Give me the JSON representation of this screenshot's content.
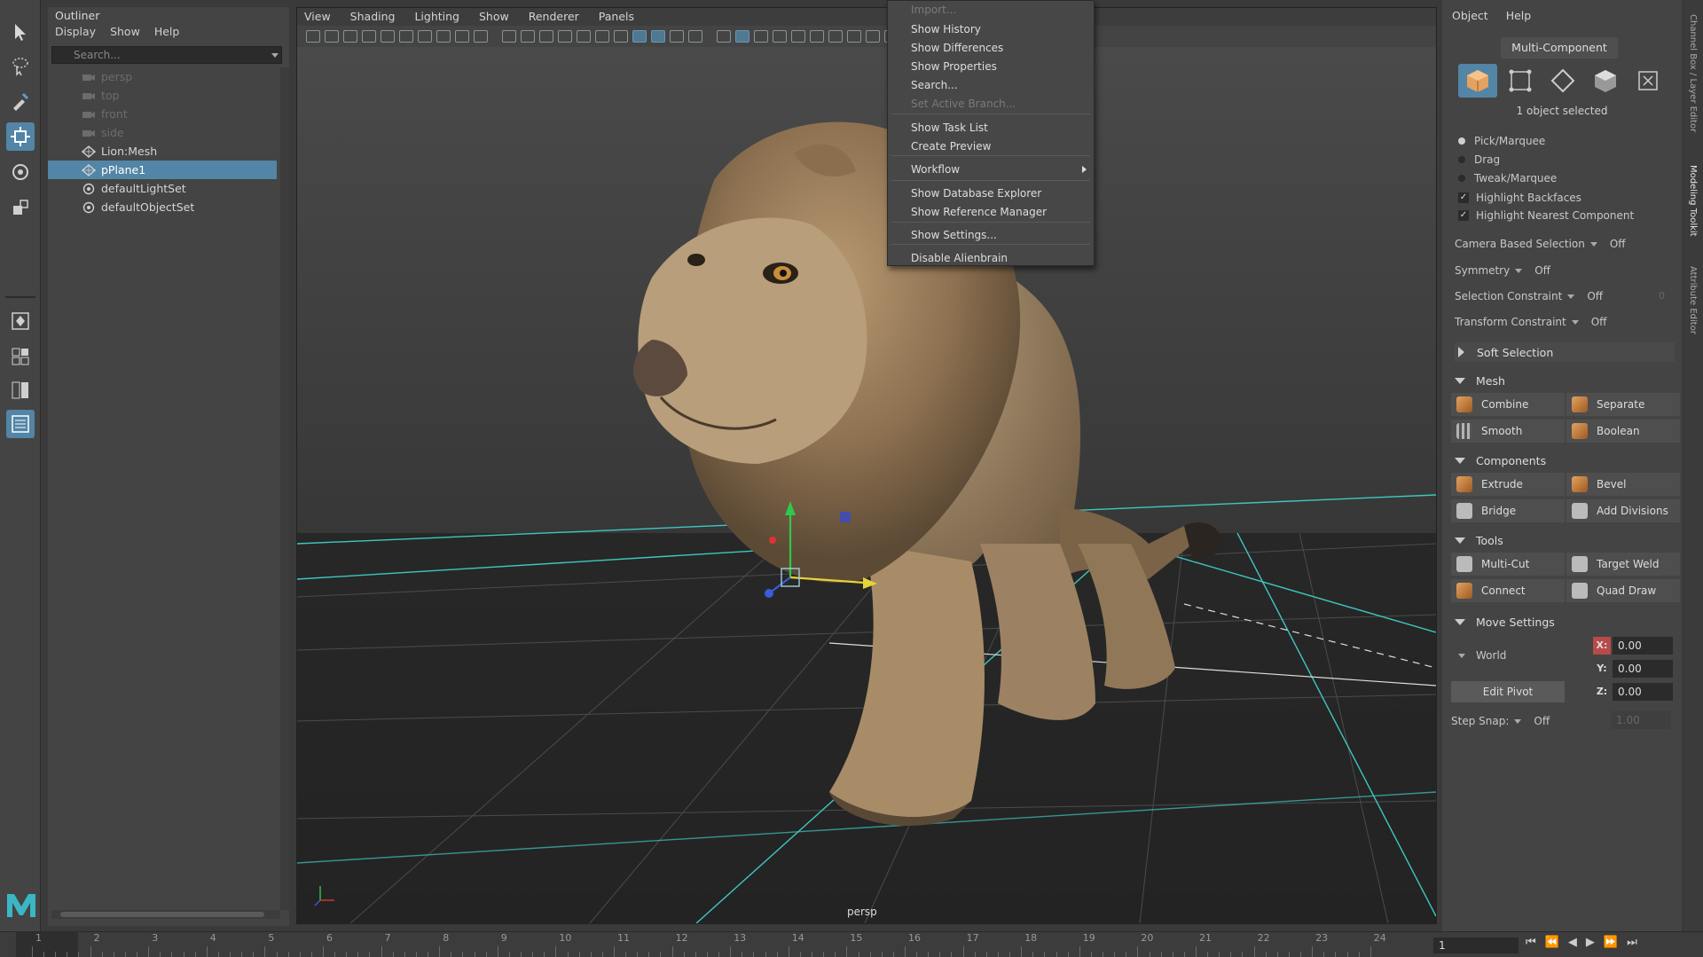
{
  "colors": {
    "accent": "#5285a6",
    "grid": "#3fc7c0",
    "x_axis": "#b84a4a"
  },
  "outliner": {
    "title": "Outliner",
    "menu": [
      "Display",
      "Show",
      "Help"
    ],
    "search_placeholder": "Search...",
    "items": [
      {
        "label": "persp",
        "icon": "camera-icon",
        "state": "dim"
      },
      {
        "label": "top",
        "icon": "camera-icon",
        "state": "dim"
      },
      {
        "label": "front",
        "icon": "camera-icon",
        "state": "dim"
      },
      {
        "label": "side",
        "icon": "camera-icon",
        "state": "dim"
      },
      {
        "label": "Lion:Mesh",
        "icon": "mesh-icon",
        "state": "normal"
      },
      {
        "label": "pPlane1",
        "icon": "mesh-icon",
        "state": "selected"
      },
      {
        "label": "defaultLightSet",
        "icon": "set-icon",
        "state": "normal"
      },
      {
        "label": "defaultObjectSet",
        "icon": "set-icon",
        "state": "normal"
      }
    ]
  },
  "viewport": {
    "menu": [
      "View",
      "Shading",
      "Lighting",
      "Show",
      "Renderer",
      "Panels"
    ],
    "camera_label": "persp"
  },
  "show_menu": {
    "items": [
      {
        "label": "Import...",
        "disabled": true
      },
      {
        "label": "Show History",
        "disabled": false
      },
      {
        "label": "Show Differences",
        "disabled": false
      },
      {
        "label": "Show Properties",
        "disabled": false
      },
      {
        "label": "Search...",
        "disabled": false
      },
      {
        "label": "Set Active Branch...",
        "disabled": true
      },
      {
        "label": "Show Task List",
        "disabled": false
      },
      {
        "label": "Create Preview",
        "disabled": false
      },
      {
        "label": "Workflow",
        "disabled": false,
        "submenu": true
      },
      {
        "label": "Show Database Explorer",
        "disabled": false
      },
      {
        "label": "Show Reference Manager",
        "disabled": false
      },
      {
        "label": "Show Settings...",
        "disabled": false
      },
      {
        "label": "Disable Alienbrain",
        "disabled": false
      }
    ]
  },
  "modeling_toolkit": {
    "menu": [
      "Object",
      "Help"
    ],
    "mode_label": "Multi-Component",
    "selection_modes": [
      "object-cube-icon",
      "vertex-icon",
      "edge-icon",
      "face-icon",
      "uv-icon"
    ],
    "selected_count_text": "1 object selected",
    "pick_options": [
      {
        "label": "Pick/Marquee",
        "selected": true
      },
      {
        "label": "Drag",
        "selected": false
      },
      {
        "label": "Tweak/Marquee",
        "selected": false
      }
    ],
    "checks": [
      {
        "label": "Highlight Backfaces",
        "checked": true
      },
      {
        "label": "Highlight Nearest Component",
        "checked": true
      }
    ],
    "dropdowns": [
      {
        "label": "Camera Based Selection",
        "value": "Off"
      },
      {
        "label": "Symmetry",
        "value": "Off"
      },
      {
        "label": "Selection Constraint",
        "value": "Off",
        "extra": "0"
      },
      {
        "label": "Transform Constraint",
        "value": "Off"
      }
    ],
    "soft_selection": "Soft Selection",
    "sections": {
      "mesh": {
        "title": "Mesh",
        "buttons": [
          "Combine",
          "Separate",
          "Smooth",
          "Boolean"
        ]
      },
      "components": {
        "title": "Components",
        "buttons": [
          "Extrude",
          "Bevel",
          "Bridge",
          "Add Divisions"
        ]
      },
      "tools": {
        "title": "Tools",
        "buttons": [
          "Multi-Cut",
          "Target Weld",
          "Connect",
          "Quad Draw"
        ]
      },
      "move_settings": {
        "title": "Move Settings"
      }
    },
    "space": "World",
    "edit_pivot": "Edit Pivot",
    "coords": [
      {
        "axis": "X:",
        "value": "0.00"
      },
      {
        "axis": "Y:",
        "value": "0.00"
      },
      {
        "axis": "Z:",
        "value": "0.00"
      }
    ],
    "step_snap_label": "Step Snap:",
    "step_snap_value": "Off",
    "step_snap_amount": "1.00"
  },
  "side_tabs": [
    "Channel Box / Layer Editor",
    "Modeling Toolkit",
    "Attribute Editor"
  ],
  "timeline": {
    "ticks": [
      "1",
      "2",
      "3",
      "4",
      "5",
      "6",
      "7",
      "8",
      "9",
      "10",
      "11",
      "12",
      "13",
      "14",
      "15",
      "16",
      "17",
      "18",
      "19",
      "20",
      "21",
      "22",
      "23",
      "24"
    ],
    "current_frame": "1"
  }
}
